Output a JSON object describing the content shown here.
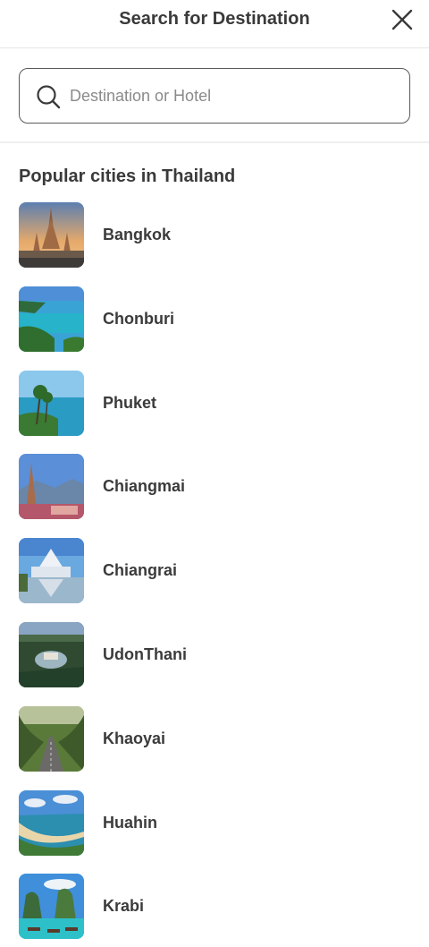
{
  "header": {
    "title": "Search for Destination"
  },
  "search": {
    "placeholder": "Destination or Hotel",
    "value": ""
  },
  "section": {
    "title": "Popular cities in Thailand"
  },
  "cities": [
    {
      "name": "Bangkok",
      "image": "temple-sunset-photo"
    },
    {
      "name": "Chonburi",
      "image": "beach-coast-photo"
    },
    {
      "name": "Phuket",
      "image": "palm-sea-photo"
    },
    {
      "name": "Chiangmai",
      "image": "pagoda-mountain-photo"
    },
    {
      "name": "Chiangrai",
      "image": "white-temple-photo"
    },
    {
      "name": "UdonThani",
      "image": "forest-valley-photo"
    },
    {
      "name": "Khaoyai",
      "image": "forest-road-photo"
    },
    {
      "name": "Huahin",
      "image": "bay-beach-photo"
    },
    {
      "name": "Krabi",
      "image": "limestone-boats-photo"
    }
  ]
}
